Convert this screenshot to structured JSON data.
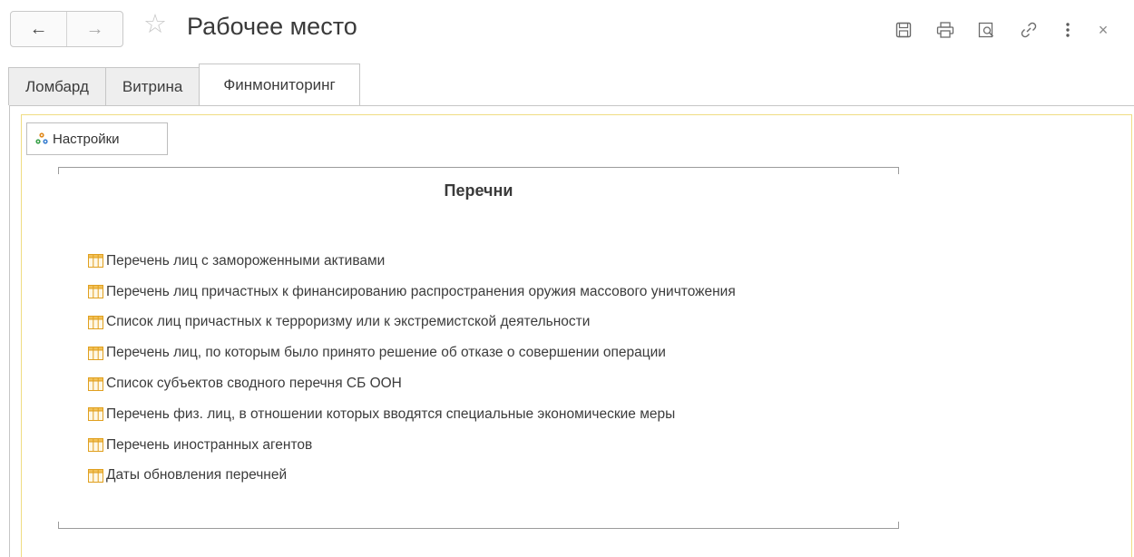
{
  "header": {
    "title": "Рабочее место",
    "nav": {
      "back_icon": "arrow-left-icon",
      "forward_icon": "arrow-right-icon"
    },
    "favorite_icon": "star-icon",
    "tools": [
      "save-icon",
      "print-icon",
      "preview-icon",
      "link-icon",
      "more-icon",
      "close-icon"
    ]
  },
  "tabs": [
    {
      "label": "Ломбард",
      "active": false
    },
    {
      "label": "Витрина",
      "active": false
    },
    {
      "label": "Финмониторинг",
      "active": true
    }
  ],
  "settings": {
    "label": "Настройки",
    "icon": "settings-icon"
  },
  "group": {
    "title": "Перечни",
    "items": [
      {
        "label": "Перечень лиц с замороженными активами",
        "icon": "table-icon"
      },
      {
        "label": "Перечень лиц причастных к финансированию распространения оружия массового уничтожения",
        "icon": "table-icon"
      },
      {
        "label": "Список лиц причастных к терроризму или к экстремистской деятельности",
        "icon": "table-icon"
      },
      {
        "label": "Перечень лиц, по которым было принято решение об отказе о совершении операции",
        "icon": "table-icon"
      },
      {
        "label": "Список субъектов сводного перечня СБ ООН",
        "icon": "table-icon"
      },
      {
        "label": "Перечень физ. лиц, в отношении которых вводятся специальные экономические меры",
        "icon": "table-icon"
      },
      {
        "label": "Перечень иностранных агентов",
        "icon": "table-icon"
      },
      {
        "label": "Даты обновления перечней",
        "icon": "table-icon"
      }
    ]
  },
  "colors": {
    "accent_focus": "#f0dc82",
    "table_icon": "#e0a020",
    "text": "#3c3c3c"
  }
}
